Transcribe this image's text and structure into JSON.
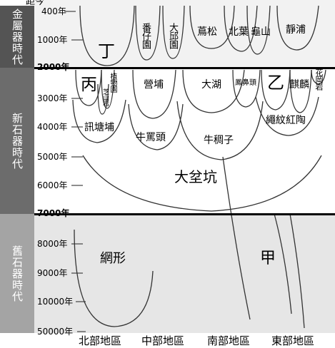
{
  "header_text": "距今",
  "eras": [
    {
      "name": "金屬器時代",
      "color": "#545454"
    },
    {
      "name": "新石器時代",
      "color": "#6c6c6c"
    },
    {
      "name": "舊石器時代",
      "color": "#a4a4a4"
    }
  ],
  "ticks": [
    "400年",
    "1000年",
    "2000年",
    "3000年",
    "4000年",
    "5000年",
    "6000年",
    "7000年",
    "8000年",
    "9000年",
    "10000年",
    "50000年"
  ],
  "regions": [
    "北部地區",
    "中部地區",
    "南部地區",
    "東部地區"
  ],
  "cultures": {
    "ding": "丁",
    "fanziyuan": "番仔園",
    "dagiuyuan": "大邱園",
    "niaosong": "蔦松",
    "beiye": "北葉",
    "guishan": "龜山",
    "jingpu": "靜浦",
    "bing": "丙",
    "zhiwuyuan": "植物園",
    "zhishanyan": "芝山岩",
    "yingpu": "營埔",
    "dahu": "大湖",
    "fengbitou": "鳳鼻頭",
    "yi": "乙",
    "qilin": "麒麟",
    "huaganshan": "花岡岩",
    "xuntangpu": "訊塘埔",
    "niumatou": "牛罵頭",
    "niuchouzi": "牛稠子",
    "shengwen": "繩紋紅陶",
    "dabenkeng": "大坌坑",
    "wangxing": "網形",
    "jia": "甲"
  }
}
